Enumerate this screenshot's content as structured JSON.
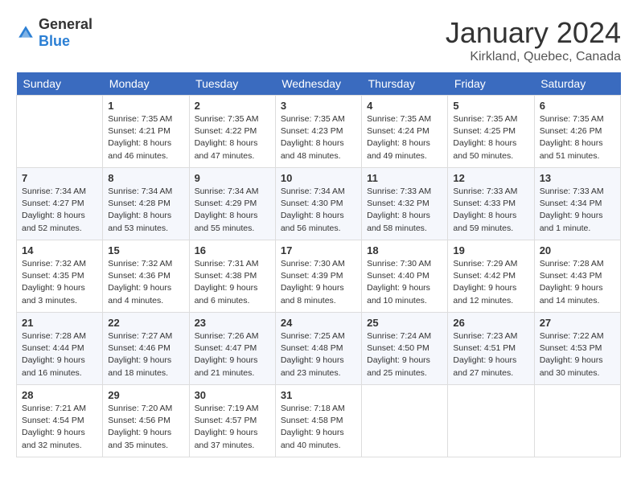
{
  "logo": {
    "text_general": "General",
    "text_blue": "Blue"
  },
  "header": {
    "month": "January 2024",
    "location": "Kirkland, Quebec, Canada"
  },
  "weekdays": [
    "Sunday",
    "Monday",
    "Tuesday",
    "Wednesday",
    "Thursday",
    "Friday",
    "Saturday"
  ],
  "weeks": [
    [
      {
        "day": "",
        "empty": true
      },
      {
        "day": "1",
        "sunrise": "Sunrise: 7:35 AM",
        "sunset": "Sunset: 4:21 PM",
        "daylight": "Daylight: 8 hours and 46 minutes."
      },
      {
        "day": "2",
        "sunrise": "Sunrise: 7:35 AM",
        "sunset": "Sunset: 4:22 PM",
        "daylight": "Daylight: 8 hours and 47 minutes."
      },
      {
        "day": "3",
        "sunrise": "Sunrise: 7:35 AM",
        "sunset": "Sunset: 4:23 PM",
        "daylight": "Daylight: 8 hours and 48 minutes."
      },
      {
        "day": "4",
        "sunrise": "Sunrise: 7:35 AM",
        "sunset": "Sunset: 4:24 PM",
        "daylight": "Daylight: 8 hours and 49 minutes."
      },
      {
        "day": "5",
        "sunrise": "Sunrise: 7:35 AM",
        "sunset": "Sunset: 4:25 PM",
        "daylight": "Daylight: 8 hours and 50 minutes."
      },
      {
        "day": "6",
        "sunrise": "Sunrise: 7:35 AM",
        "sunset": "Sunset: 4:26 PM",
        "daylight": "Daylight: 8 hours and 51 minutes."
      }
    ],
    [
      {
        "day": "7",
        "sunrise": "Sunrise: 7:34 AM",
        "sunset": "Sunset: 4:27 PM",
        "daylight": "Daylight: 8 hours and 52 minutes."
      },
      {
        "day": "8",
        "sunrise": "Sunrise: 7:34 AM",
        "sunset": "Sunset: 4:28 PM",
        "daylight": "Daylight: 8 hours and 53 minutes."
      },
      {
        "day": "9",
        "sunrise": "Sunrise: 7:34 AM",
        "sunset": "Sunset: 4:29 PM",
        "daylight": "Daylight: 8 hours and 55 minutes."
      },
      {
        "day": "10",
        "sunrise": "Sunrise: 7:34 AM",
        "sunset": "Sunset: 4:30 PM",
        "daylight": "Daylight: 8 hours and 56 minutes."
      },
      {
        "day": "11",
        "sunrise": "Sunrise: 7:33 AM",
        "sunset": "Sunset: 4:32 PM",
        "daylight": "Daylight: 8 hours and 58 minutes."
      },
      {
        "day": "12",
        "sunrise": "Sunrise: 7:33 AM",
        "sunset": "Sunset: 4:33 PM",
        "daylight": "Daylight: 8 hours and 59 minutes."
      },
      {
        "day": "13",
        "sunrise": "Sunrise: 7:33 AM",
        "sunset": "Sunset: 4:34 PM",
        "daylight": "Daylight: 9 hours and 1 minute."
      }
    ],
    [
      {
        "day": "14",
        "sunrise": "Sunrise: 7:32 AM",
        "sunset": "Sunset: 4:35 PM",
        "daylight": "Daylight: 9 hours and 3 minutes."
      },
      {
        "day": "15",
        "sunrise": "Sunrise: 7:32 AM",
        "sunset": "Sunset: 4:36 PM",
        "daylight": "Daylight: 9 hours and 4 minutes."
      },
      {
        "day": "16",
        "sunrise": "Sunrise: 7:31 AM",
        "sunset": "Sunset: 4:38 PM",
        "daylight": "Daylight: 9 hours and 6 minutes."
      },
      {
        "day": "17",
        "sunrise": "Sunrise: 7:30 AM",
        "sunset": "Sunset: 4:39 PM",
        "daylight": "Daylight: 9 hours and 8 minutes."
      },
      {
        "day": "18",
        "sunrise": "Sunrise: 7:30 AM",
        "sunset": "Sunset: 4:40 PM",
        "daylight": "Daylight: 9 hours and 10 minutes."
      },
      {
        "day": "19",
        "sunrise": "Sunrise: 7:29 AM",
        "sunset": "Sunset: 4:42 PM",
        "daylight": "Daylight: 9 hours and 12 minutes."
      },
      {
        "day": "20",
        "sunrise": "Sunrise: 7:28 AM",
        "sunset": "Sunset: 4:43 PM",
        "daylight": "Daylight: 9 hours and 14 minutes."
      }
    ],
    [
      {
        "day": "21",
        "sunrise": "Sunrise: 7:28 AM",
        "sunset": "Sunset: 4:44 PM",
        "daylight": "Daylight: 9 hours and 16 minutes."
      },
      {
        "day": "22",
        "sunrise": "Sunrise: 7:27 AM",
        "sunset": "Sunset: 4:46 PM",
        "daylight": "Daylight: 9 hours and 18 minutes."
      },
      {
        "day": "23",
        "sunrise": "Sunrise: 7:26 AM",
        "sunset": "Sunset: 4:47 PM",
        "daylight": "Daylight: 9 hours and 21 minutes."
      },
      {
        "day": "24",
        "sunrise": "Sunrise: 7:25 AM",
        "sunset": "Sunset: 4:48 PM",
        "daylight": "Daylight: 9 hours and 23 minutes."
      },
      {
        "day": "25",
        "sunrise": "Sunrise: 7:24 AM",
        "sunset": "Sunset: 4:50 PM",
        "daylight": "Daylight: 9 hours and 25 minutes."
      },
      {
        "day": "26",
        "sunrise": "Sunrise: 7:23 AM",
        "sunset": "Sunset: 4:51 PM",
        "daylight": "Daylight: 9 hours and 27 minutes."
      },
      {
        "day": "27",
        "sunrise": "Sunrise: 7:22 AM",
        "sunset": "Sunset: 4:53 PM",
        "daylight": "Daylight: 9 hours and 30 minutes."
      }
    ],
    [
      {
        "day": "28",
        "sunrise": "Sunrise: 7:21 AM",
        "sunset": "Sunset: 4:54 PM",
        "daylight": "Daylight: 9 hours and 32 minutes."
      },
      {
        "day": "29",
        "sunrise": "Sunrise: 7:20 AM",
        "sunset": "Sunset: 4:56 PM",
        "daylight": "Daylight: 9 hours and 35 minutes."
      },
      {
        "day": "30",
        "sunrise": "Sunrise: 7:19 AM",
        "sunset": "Sunset: 4:57 PM",
        "daylight": "Daylight: 9 hours and 37 minutes."
      },
      {
        "day": "31",
        "sunrise": "Sunrise: 7:18 AM",
        "sunset": "Sunset: 4:58 PM",
        "daylight": "Daylight: 9 hours and 40 minutes."
      },
      {
        "day": "",
        "empty": true
      },
      {
        "day": "",
        "empty": true
      },
      {
        "day": "",
        "empty": true
      }
    ]
  ]
}
